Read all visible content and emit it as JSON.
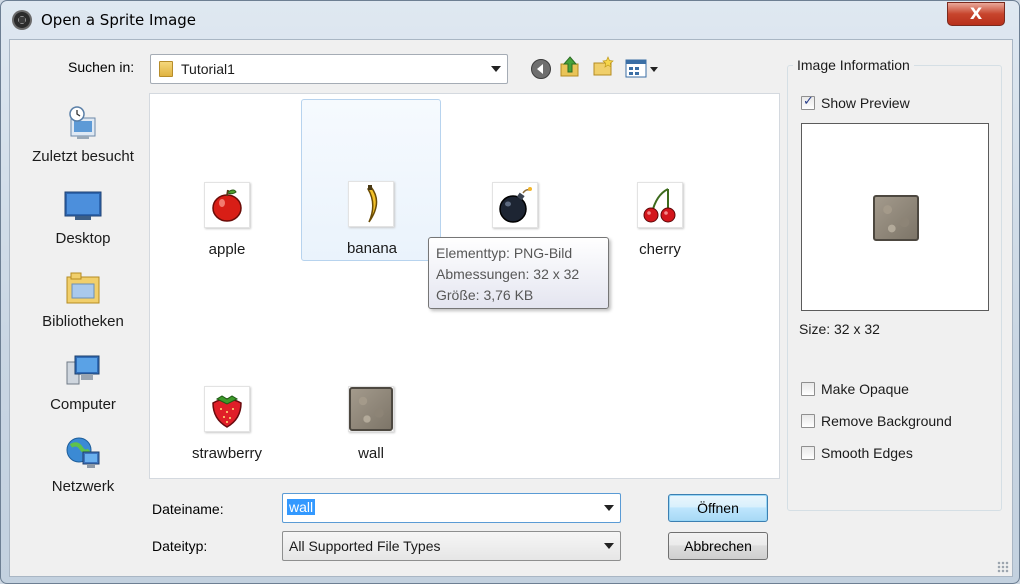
{
  "window": {
    "title": "Open a Sprite Image",
    "close_glyph": "X"
  },
  "lookin": {
    "label": "Suchen in:",
    "value": "Tutorial1"
  },
  "places": [
    {
      "label": "Zuletzt besucht",
      "icon": "recent-places-icon"
    },
    {
      "label": "Desktop",
      "icon": "desktop-icon"
    },
    {
      "label": "Bibliotheken",
      "icon": "libraries-icon"
    },
    {
      "label": "Computer",
      "icon": "computer-icon"
    },
    {
      "label": "Netzwerk",
      "icon": "network-icon"
    }
  ],
  "files": [
    {
      "label": "apple",
      "icon": "apple-icon"
    },
    {
      "label": "banana",
      "icon": "banana-icon",
      "selected": true
    },
    {
      "label": "",
      "icon": "bomb-icon"
    },
    {
      "label": "cherry",
      "icon": "cherry-icon"
    },
    {
      "label": "strawberry",
      "icon": "strawberry-icon"
    },
    {
      "label": "wall",
      "icon": "wall-icon"
    }
  ],
  "tooltip": {
    "line1": "Elementtyp: PNG-Bild",
    "line2": "Abmessungen: 32 x 32",
    "line3": "Größe: 3,76 KB"
  },
  "filename": {
    "label": "Dateiname:",
    "value": "wall"
  },
  "filetype": {
    "label": "Dateityp:",
    "value": "All Supported File Types"
  },
  "buttons": {
    "open": "Öffnen",
    "cancel": "Abbrechen"
  },
  "info": {
    "title": "Image Information",
    "show_preview": "Show Preview",
    "show_preview_checked": true,
    "size": "Size: 32 x 32",
    "make_opaque": "Make Opaque",
    "remove_background": "Remove Background",
    "smooth_edges": "Smooth Edges"
  },
  "colors": {
    "selection": "#3399ff",
    "title_bar": "#c9d6e3",
    "close_button": "#c7452d"
  }
}
